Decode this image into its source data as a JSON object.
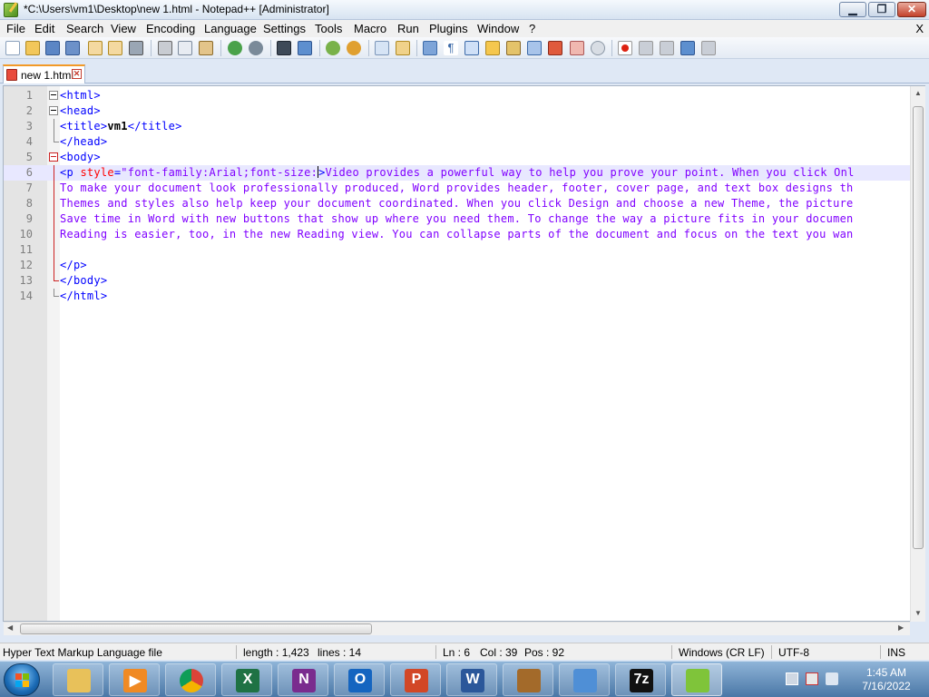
{
  "window": {
    "title": "*C:\\Users\\vm1\\Desktop\\new 1.html - Notepad++ [Administrator]",
    "minimize_glyph": "▁",
    "maximize_glyph": "❐",
    "close_glyph": "✕"
  },
  "menu": {
    "items": [
      "File",
      "Edit",
      "Search",
      "View",
      "Encoding",
      "Language",
      "Settings",
      "Tools",
      "Macro",
      "Run",
      "Plugins",
      "Window",
      "?"
    ],
    "close_label": "X"
  },
  "toolbar": {
    "icons": [
      "new-file-icon",
      "open-file-icon",
      "save-icon",
      "save-all-icon",
      "close-icon",
      "close-all-icon",
      "print-icon",
      "cut-icon",
      "copy-icon",
      "paste-icon",
      "undo-icon",
      "redo-icon",
      "find-icon",
      "replace-icon",
      "zoom-in-icon",
      "zoom-out-icon",
      "sync-vertical-icon",
      "sync-horizontal-icon",
      "word-wrap-icon",
      "show-all-chars-icon",
      "indent-guide-icon",
      "define-language-icon",
      "doc-map-icon",
      "function-list-icon",
      "folder-workspace-icon",
      "doc-monitor-icon",
      "record-macro-icon",
      "stop-record-icon",
      "play-macro-icon",
      "run-macro-multiple-icon",
      "save-macro-icon"
    ]
  },
  "tabs": [
    {
      "label": "new 1.html",
      "close_glyph": "✕",
      "modified": true
    }
  ],
  "editor": {
    "lines": [
      {
        "num": "1",
        "tokens": [
          {
            "t": "<html>",
            "c": "tagc"
          }
        ]
      },
      {
        "num": "2",
        "tokens": [
          {
            "t": "<head>",
            "c": "tagc"
          }
        ]
      },
      {
        "num": "3",
        "tokens": [
          {
            "t": "<title>",
            "c": "tagc"
          },
          {
            "t": "vm1",
            "c": "textc"
          },
          {
            "t": "</title>",
            "c": "tagc"
          }
        ]
      },
      {
        "num": "4",
        "tokens": [
          {
            "t": "</head>",
            "c": "tagc"
          }
        ]
      },
      {
        "num": "5",
        "tokens": [
          {
            "t": "<body>",
            "c": "tagc"
          }
        ]
      },
      {
        "num": "6",
        "tokens": [
          {
            "t": "<p ",
            "c": "tagc"
          },
          {
            "t": "style",
            "c": "attrc"
          },
          {
            "t": "=",
            "c": "tagc"
          },
          {
            "t": "\"font-family:Arial;font-size:",
            "c": "strc"
          },
          {
            "t": "|",
            "c": "caret"
          },
          {
            "t": ">",
            "c": "tagc"
          },
          {
            "t": "Video provides a powerful way to help you prove your point. When you click Onl",
            "c": "strc"
          }
        ]
      },
      {
        "num": "7",
        "tokens": [
          {
            "t": "To make your document look professionally produced, Word provides header, footer, cover page, and text box designs th",
            "c": "strc"
          }
        ]
      },
      {
        "num": "8",
        "tokens": [
          {
            "t": "Themes and styles also help keep your document coordinated. When you click Design and choose a new Theme, the picture",
            "c": "strc"
          }
        ]
      },
      {
        "num": "9",
        "tokens": [
          {
            "t": "Save time in Word with new buttons that show up where you need them. To change the way a picture fits in your documen",
            "c": "strc"
          }
        ]
      },
      {
        "num": "10",
        "tokens": [
          {
            "t": "Reading is easier, too, in the new Reading view. You can collapse parts of the document and focus on the text you wan",
            "c": "strc"
          }
        ]
      },
      {
        "num": "11",
        "tokens": []
      },
      {
        "num": "12",
        "tokens": [
          {
            "t": "</p>",
            "c": "tagc"
          }
        ]
      },
      {
        "num": "13",
        "tokens": [
          {
            "t": "</body>",
            "c": "tagc"
          }
        ]
      },
      {
        "num": "14",
        "tokens": [
          {
            "t": "</html>",
            "c": "tagc"
          }
        ]
      }
    ],
    "current_line": "6"
  },
  "status": {
    "file_type": "Hyper Text Markup Language file",
    "length": "length : 1,423",
    "lines": "lines : 14",
    "ln": "Ln : 6",
    "col": "Col : 39",
    "pos": "Pos : 92",
    "eol": "Windows (CR LF)",
    "encoding": "UTF-8",
    "mode": "INS"
  },
  "taskbar": {
    "apps": [
      {
        "name": "explorer",
        "icon": "folder-icon",
        "color": "#e8c15a",
        "letter": ""
      },
      {
        "name": "media-player",
        "icon": "media-player-icon",
        "color": "#f08a24",
        "letter": "▶"
      },
      {
        "name": "chrome",
        "icon": "chrome-icon",
        "color": "#db4437",
        "letter": ""
      },
      {
        "name": "excel",
        "icon": "excel-icon",
        "color": "#1f7244",
        "letter": "X"
      },
      {
        "name": "onenote",
        "icon": "onenote-icon",
        "color": "#7a2c8e",
        "letter": "N"
      },
      {
        "name": "outlook",
        "icon": "outlook-icon",
        "color": "#1565c0",
        "letter": "O"
      },
      {
        "name": "powerpoint",
        "icon": "powerpoint-icon",
        "color": "#d24726",
        "letter": "P"
      },
      {
        "name": "word",
        "icon": "word-icon",
        "color": "#2b579a",
        "letter": "W"
      },
      {
        "name": "treasure-app",
        "icon": "treasure-chest-icon",
        "color": "#a36a2a",
        "letter": ""
      },
      {
        "name": "control-panel",
        "icon": "control-panel-icon",
        "color": "#4f8fd6",
        "letter": ""
      },
      {
        "name": "7zip",
        "icon": "7zip-icon",
        "color": "#111111",
        "letter": "7z"
      },
      {
        "name": "notepadpp",
        "icon": "notepadpp-icon",
        "color": "#7fc43a",
        "letter": ""
      }
    ],
    "clock_time": "1:45 AM",
    "clock_date": "7/16/2022"
  }
}
